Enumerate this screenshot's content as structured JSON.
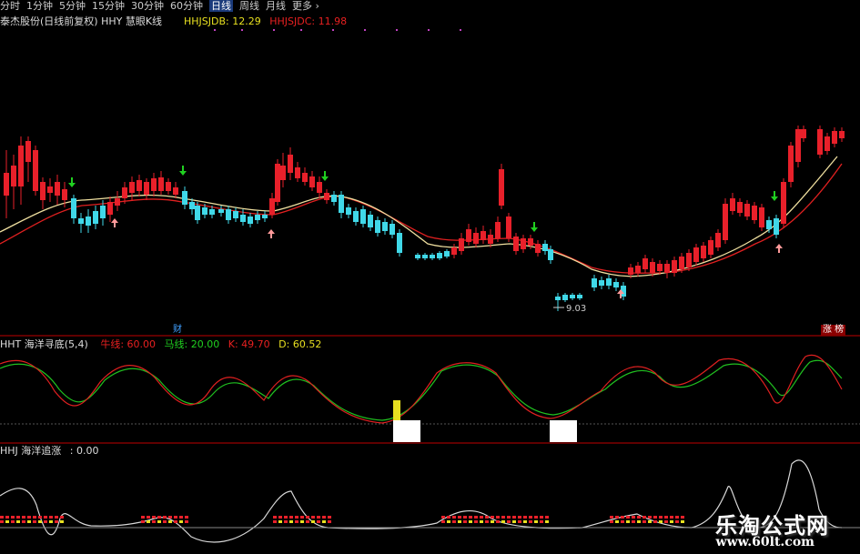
{
  "toolbar": {
    "items": [
      "分时",
      "1分钟",
      "5分钟",
      "15分钟",
      "30分钟",
      "60分钟",
      "日线",
      "周线",
      "月线",
      "更多"
    ],
    "active_index": 6
  },
  "main_panel": {
    "title": "泰杰股份(日线前复权) HHY 慧眼K线",
    "indicator_a_label": "HHJSJDB: 12.29",
    "indicator_b_label": "HHJSJDC: 11.98",
    "low_price_label": "9.03",
    "marker_left": "财",
    "marker_right": "涨 榜"
  },
  "kd_panel": {
    "title": "HHT 海洋寻底(5,4)",
    "line_a": "牛线: 60.00",
    "line_b": "马线: 20.00",
    "k": "K: 49.70",
    "d": "D: 60.52"
  },
  "hhj_panel": {
    "title": "HHJ 海洋追涨",
    "value": ": 0.00"
  },
  "watermark": {
    "name": "乐淘公式网",
    "url": "www.60lt.com"
  },
  "colors": {
    "up": "#e8202a",
    "down": "#40d8e8",
    "ma_fast": "#f0e0a0",
    "ma_slow": "#e02020",
    "k_line": "#e02020",
    "d_line": "#20c020",
    "title_yellow": "#e8e020",
    "signal_green": "#20d020",
    "signal_pink": "#ff9a9a",
    "divider": "#c00000"
  }
}
